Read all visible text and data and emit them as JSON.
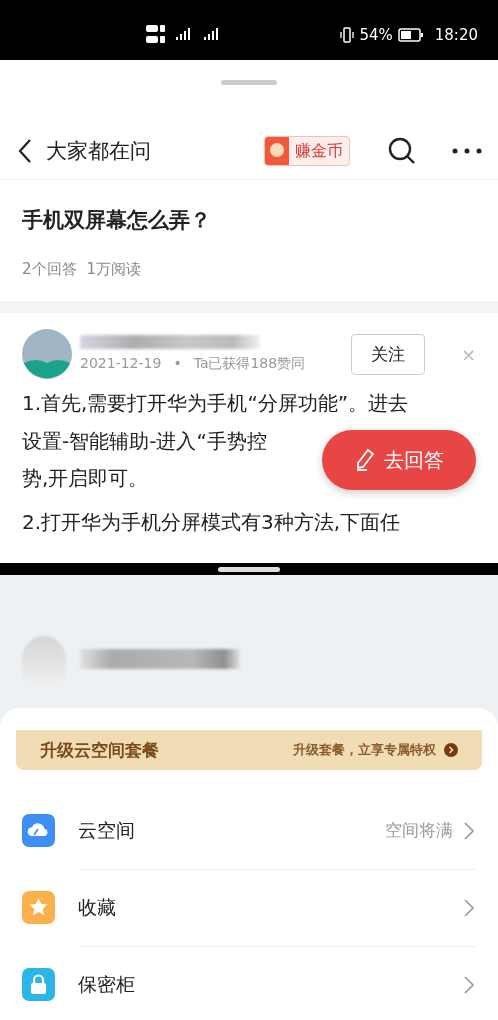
{
  "status_bar": {
    "battery": "54%",
    "time": "18:20"
  },
  "top_app": {
    "nav": {
      "title": "大家都在问",
      "coin_badge": "赚金币"
    },
    "question": {
      "title": "手机双屏幕怎么弄？",
      "meta": [
        "2个回答",
        "1万阅读"
      ]
    },
    "answer": {
      "date": "2021-12-19",
      "separator": "•",
      "likes": "Ta已获得188赞同",
      "follow_button": "关注",
      "close": "×",
      "paragraphs": [
        {
          "lines": [
            "1.首先,需要打开华为手机“分屏功能”。进去",
            "设置-智能辅助-进入“手势控",
            "势,开启即可。"
          ]
        },
        {
          "lines": [
            "2.打开华为手机分屏模式有3种方法,下面任"
          ]
        }
      ],
      "fab": "去回答"
    }
  },
  "bottom_app": {
    "banner": {
      "title": "升级云空间套餐",
      "subtitle": "升级套餐，立享专属特权"
    },
    "items": [
      {
        "kind": "cloud",
        "label": "云空间",
        "value": "空间将满"
      },
      {
        "kind": "star",
        "label": "收藏"
      },
      {
        "kind": "lock",
        "label": "保密柜"
      }
    ]
  }
}
